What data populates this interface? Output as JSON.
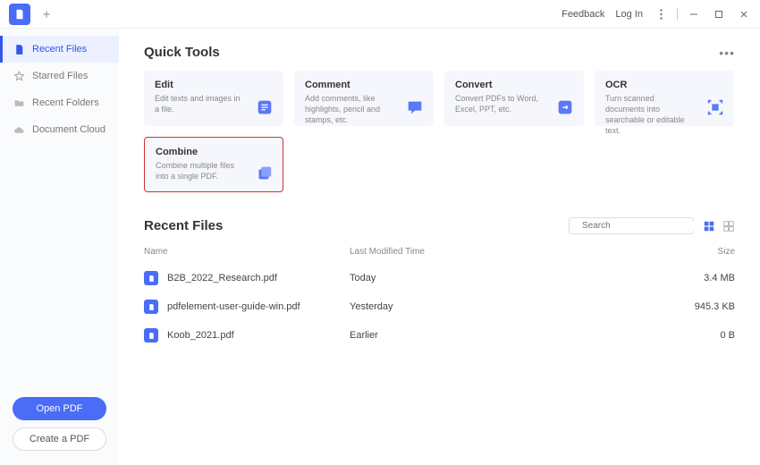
{
  "titlebar": {
    "feedback": "Feedback",
    "login": "Log In"
  },
  "sidebar": {
    "items": [
      {
        "label": "Recent Files"
      },
      {
        "label": "Starred Files"
      },
      {
        "label": "Recent Folders"
      },
      {
        "label": "Document Cloud"
      }
    ],
    "open_label": "Open PDF",
    "create_label": "Create a PDF"
  },
  "quicktools": {
    "title": "Quick Tools",
    "cards": [
      {
        "title": "Edit",
        "desc": "Edit texts and images in a file."
      },
      {
        "title": "Comment",
        "desc": "Add comments, like highlights, pencil and stamps, etc."
      },
      {
        "title": "Convert",
        "desc": "Convert PDFs to Word, Excel, PPT, etc."
      },
      {
        "title": "OCR",
        "desc": "Turn scanned documents into searchable or editable text."
      },
      {
        "title": "Combine",
        "desc": "Combine multiple files into a single PDF."
      }
    ]
  },
  "recent": {
    "title": "Recent Files",
    "search_placeholder": "Search",
    "columns": {
      "name": "Name",
      "modified": "Last Modified Time",
      "size": "Size"
    },
    "files": [
      {
        "name": "B2B_2022_Research.pdf",
        "modified": "Today",
        "size": "3.4 MB"
      },
      {
        "name": "pdfelement-user-guide-win.pdf",
        "modified": "Yesterday",
        "size": "945.3 KB"
      },
      {
        "name": "Koob_2021.pdf",
        "modified": "Earlier",
        "size": "0 B"
      }
    ]
  }
}
